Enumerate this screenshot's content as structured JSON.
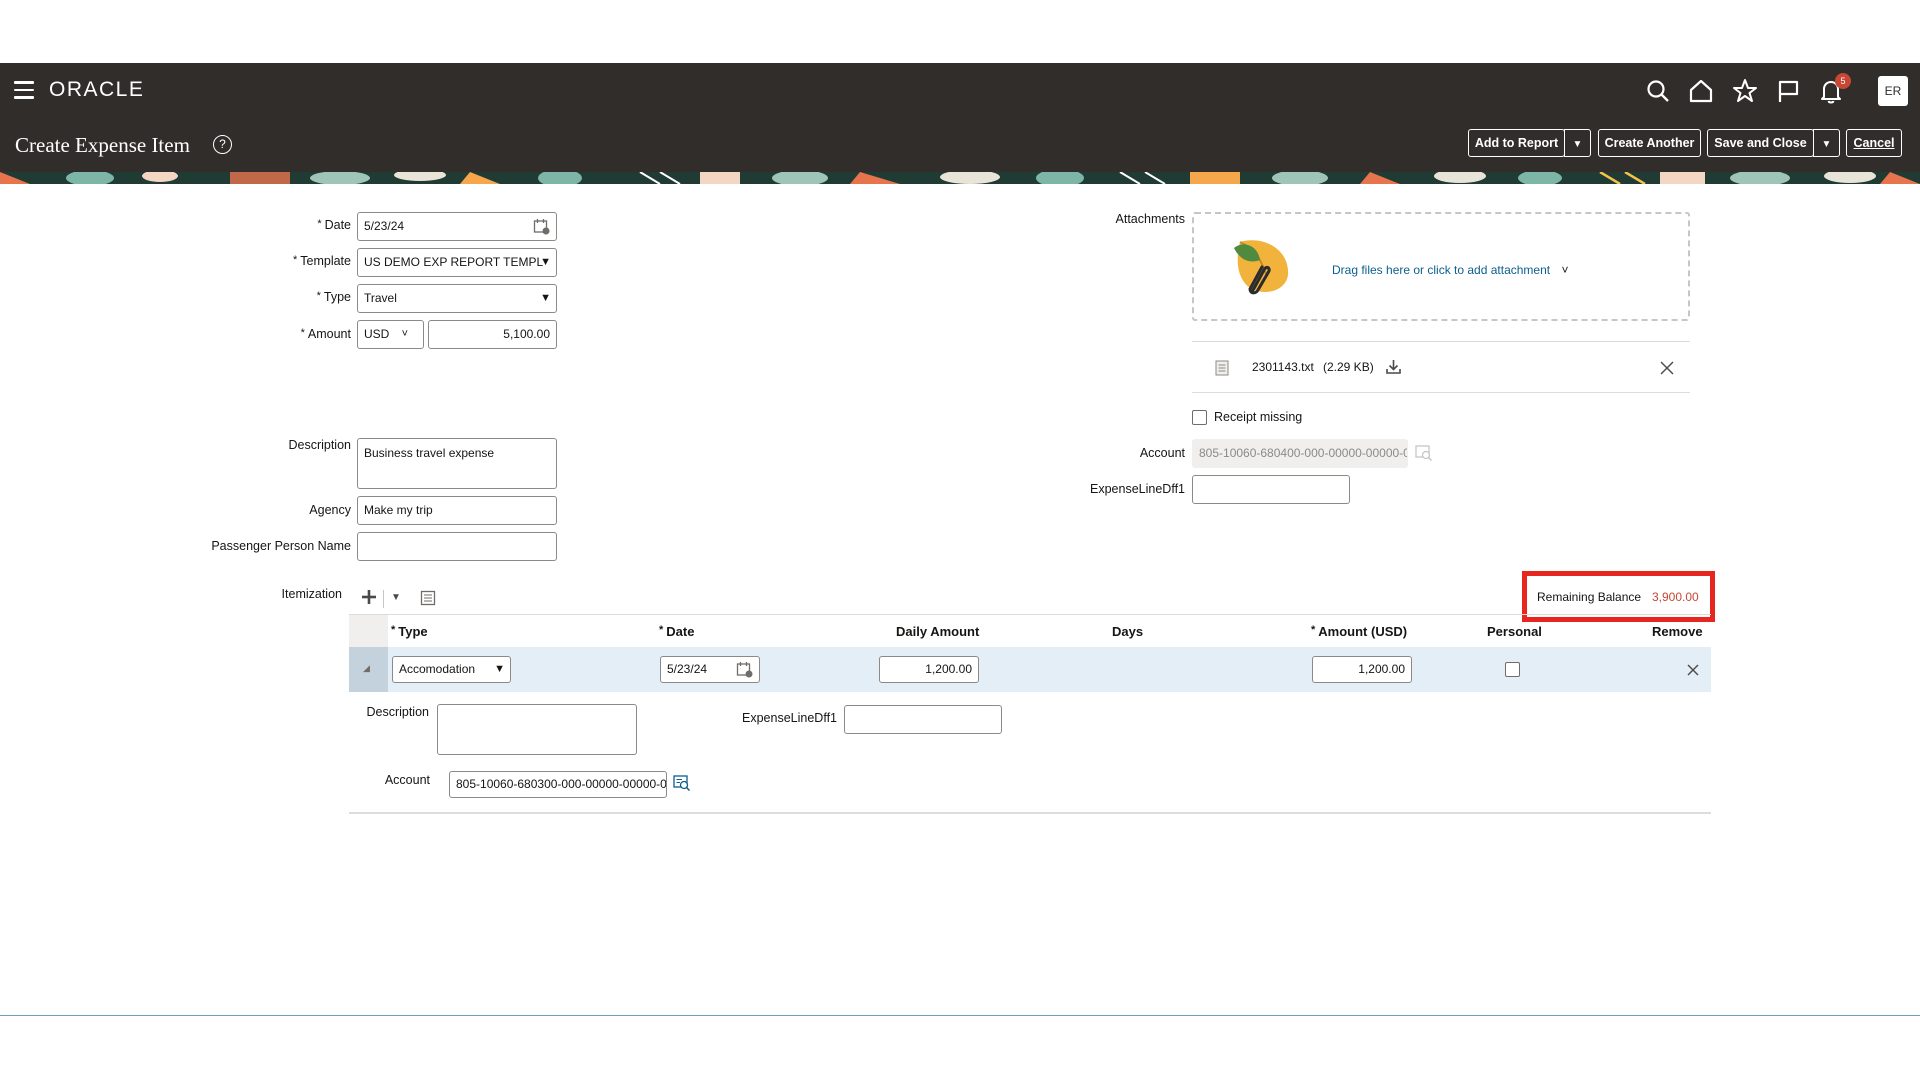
{
  "app": {
    "logo": "ORACLE",
    "page_title": "Create Expense Item",
    "notification_count": "5",
    "avatar_initials": "ER"
  },
  "header_icons": [
    "search-icon",
    "home-icon",
    "star-icon",
    "flag-icon",
    "bell-icon"
  ],
  "actions": {
    "add_to_report": "Add to Report",
    "create_another": "Create Another",
    "save_and_close": "Save and Close",
    "cancel": "Cancel",
    "dropdown_caret": "▼"
  },
  "form": {
    "date": {
      "label": "Date",
      "value": "5/23/24",
      "required": "*"
    },
    "template": {
      "label": "Template",
      "value": "US DEMO EXP REPORT TEMPL",
      "required": "*"
    },
    "type": {
      "label": "Type",
      "value": "Travel",
      "required": "*"
    },
    "amount": {
      "label": "Amount",
      "currency": "USD",
      "value": "5,100.00",
      "required": "*"
    },
    "description": {
      "label": "Description",
      "value": "Business travel expense"
    },
    "agency": {
      "label": "Agency",
      "value": "Make my trip"
    },
    "passenger": {
      "label": "Passenger Person Name",
      "value": ""
    }
  },
  "attachments": {
    "label": "Attachments",
    "drop_text": "Drag files here or click to add attachment",
    "file_name": "2301143.txt",
    "file_size": "(2.29 KB)"
  },
  "receipt_missing": {
    "label": "Receipt missing",
    "checked": false
  },
  "account": {
    "label": "Account",
    "value": "805-10060-680400-000-00000-00000-0"
  },
  "expense_line_dff": {
    "label": "ExpenseLineDff1",
    "value": ""
  },
  "itemization": {
    "label": "Itemization",
    "remaining_balance_label": "Remaining Balance",
    "remaining_balance_value": "3,900.00",
    "columns": {
      "type": "Type",
      "date": "Date",
      "daily_amount": "Daily Amount",
      "days": "Days",
      "amount_usd": "Amount (USD)",
      "personal": "Personal",
      "remove": "Remove",
      "required": "*"
    },
    "row": {
      "type": "Accomodation",
      "date": "5/23/24",
      "daily_amount": "1,200.00",
      "days": "",
      "amount": "1,200.00",
      "personal": false
    },
    "detail": {
      "description_label": "Description",
      "description_value": "",
      "dff_label": "ExpenseLineDff1",
      "dff_value": "",
      "account_label": "Account",
      "account_value": "805-10060-680300-000-00000-00000-0"
    }
  },
  "colors": {
    "header_bg": "#312d2a",
    "highlight_red": "#e6261f",
    "balance_red": "#c74634",
    "row_highlight": "#e4eef6",
    "link_blue": "#0c5f8d"
  }
}
